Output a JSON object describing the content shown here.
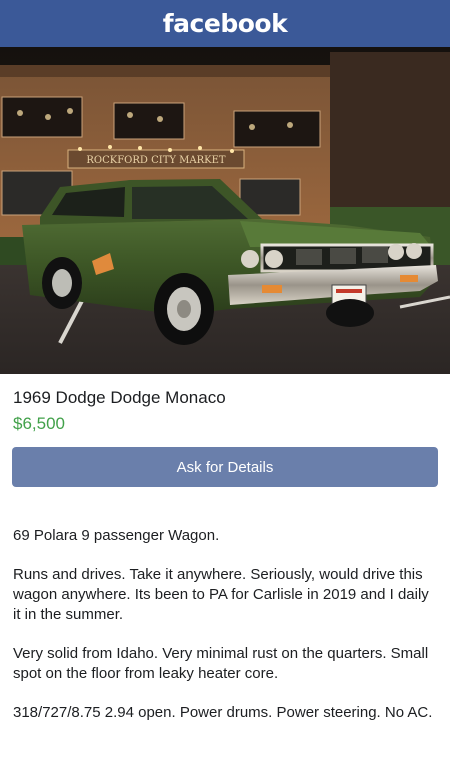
{
  "header": {
    "logo_text": "facebook",
    "color": "#3b5998"
  },
  "photo": {
    "sign_text": "ROCKFORD CITY MARKET",
    "plate_text": ""
  },
  "listing": {
    "title": "1969 Dodge Dodge Monaco",
    "price": "$6,500",
    "price_color": "#42a14a"
  },
  "actions": {
    "ask_label": "Ask for Details",
    "button_color": "#6a7fab"
  },
  "description": {
    "paragraphs": [
      "69 Polara 9 passenger Wagon.",
      "Runs and drives. Take it anywhere. Seriously, would drive this wagon anywhere. Its been to PA for Carlisle in 2019 and I daily it in the summer.",
      "Very solid from Idaho. Very minimal rust on the quarters. Small spot on the floor from leaky heater core.",
      "318/727/8.75 2.94 open. Power drums. Power steering. No AC."
    ]
  }
}
